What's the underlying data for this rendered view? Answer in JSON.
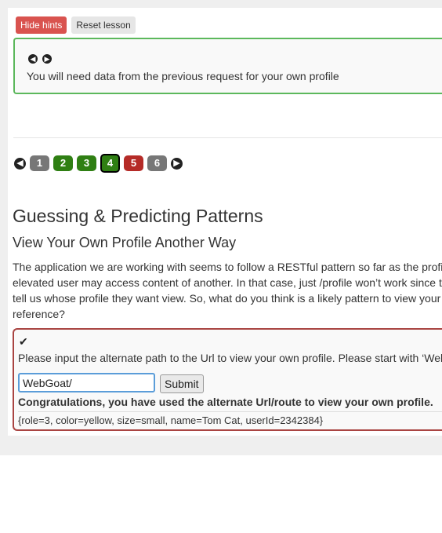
{
  "toolbar": {
    "hide_hints": "Hide hints",
    "reset_lesson": "Reset lesson"
  },
  "hint": {
    "prev_icon": "arrow-left-circle",
    "next_icon": "arrow-right-circle",
    "text": "You will need data from the previous request for your own profile"
  },
  "pagination": {
    "pages": [
      "1",
      "2",
      "3",
      "4",
      "5",
      "6"
    ],
    "states": [
      "grey",
      "green",
      "green",
      "active",
      "red",
      "grey"
    ],
    "current": "4"
  },
  "content": {
    "title": "Guessing & Predicting Patterns",
    "subtitle": "View Your Own Profile Another Way",
    "paragraph_lines": [
      "The application we are working with seems to follow a RESTful pattern so far as the profi",
      "elevated user may access content of another. In that case, just /profile won’t work since t",
      "tell us whose profile they want view. So, what do you think is a likely pattern to view your",
      "reference?"
    ]
  },
  "attack": {
    "status_icon": "check",
    "prompt": "Please input the alternate path to the Url to view your own profile. Please start with ‘Wel",
    "input_value": "WebGoat/",
    "submit_label": "Submit",
    "success": "Congratulations, you have used the alternate Url/route to view your own profile.",
    "output": "{role=3, color=yellow, size=small, name=Tom Cat, userId=2342384}"
  },
  "colors": {
    "success": "#5cb85c",
    "danger": "#a94442",
    "page_green": "#2f7f13",
    "page_red": "#b52b27"
  }
}
